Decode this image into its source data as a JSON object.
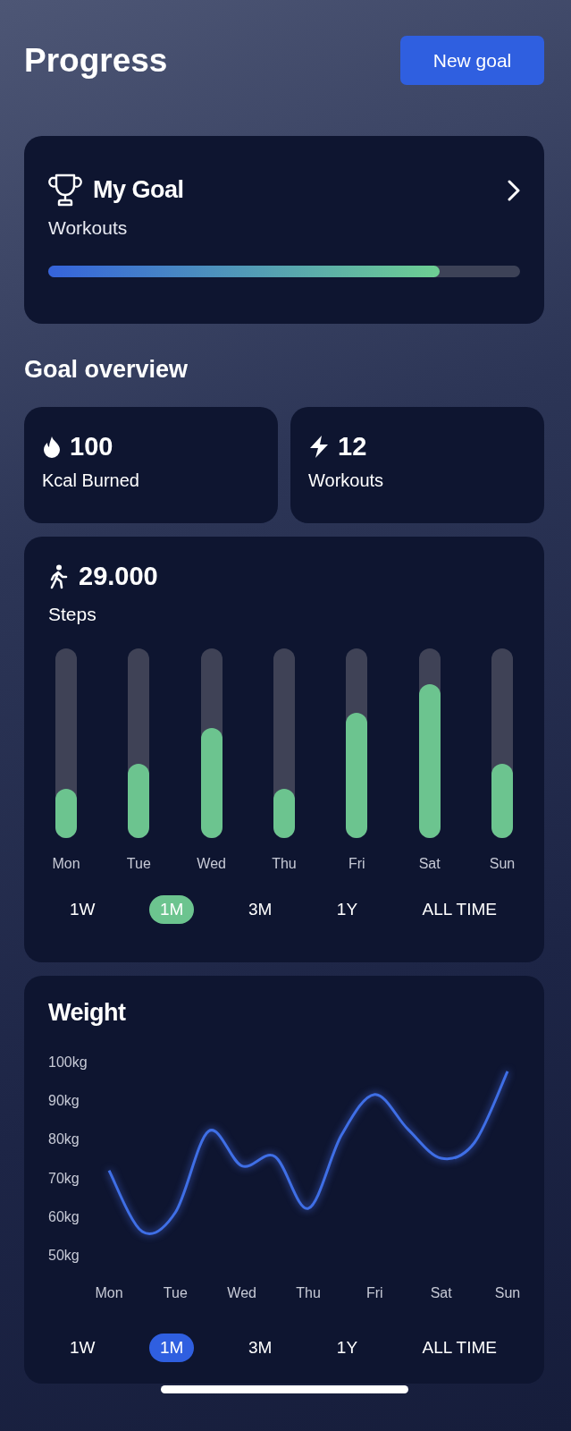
{
  "header": {
    "title": "Progress",
    "button": "New goal"
  },
  "goal_card": {
    "title": "My Goal",
    "subtitle": "Workouts",
    "level": 0.83
  },
  "section_title": "Goal overview",
  "stats": [
    {
      "kind": "flame",
      "value": "100",
      "label": "Kcal Burned"
    },
    {
      "kind": "bolt",
      "value": "12",
      "label": "Workouts"
    }
  ],
  "steps_card": {
    "value": "29.000",
    "label": "Steps",
    "bars": [
      {
        "day": "Mon",
        "level": 0.26
      },
      {
        "day": "Tue",
        "level": 0.39
      },
      {
        "day": "Wed",
        "level": 0.58
      },
      {
        "day": "Thu",
        "level": 0.26
      },
      {
        "day": "Fri",
        "level": 0.66
      },
      {
        "day": "Sat",
        "level": 0.81
      },
      {
        "day": "Sun",
        "level": 0.39
      }
    ],
    "ranges": [
      {
        "label": "1W",
        "selected": false
      },
      {
        "label": "1M",
        "selected": true
      },
      {
        "label": "3M",
        "selected": false
      },
      {
        "label": "1Y",
        "selected": false
      },
      {
        "label": "ALL TIME",
        "selected": false
      }
    ]
  },
  "weight_card": {
    "title": "Weight",
    "chart_data": {
      "type": "line",
      "categories": [
        "Mon",
        null,
        "Tue",
        null,
        "Wed",
        null,
        "Thu",
        null,
        "Fri",
        null,
        "Sat",
        null,
        "Sun"
      ],
      "series": [
        {
          "color": "#3f6fe6",
          "values": [
            71.8,
            56,
            61,
            82,
            73,
            75.4,
            62,
            81,
            91.5,
            82.5,
            75,
            79,
            97.5
          ]
        }
      ],
      "ylim": [
        50,
        100
      ],
      "yticks": [
        {
          "value": 100,
          "label": "100kg"
        },
        {
          "value": 90,
          "label": "90kg"
        },
        {
          "value": 80,
          "label": "80kg"
        },
        {
          "value": 70,
          "label": "70kg"
        },
        {
          "value": 60,
          "label": "60kg"
        },
        {
          "value": 50,
          "label": "50kg"
        }
      ]
    },
    "ranges": [
      {
        "label": "1W",
        "selected": false
      },
      {
        "label": "1M",
        "selected": true
      },
      {
        "label": "3M",
        "selected": false
      },
      {
        "label": "1Y",
        "selected": false
      },
      {
        "label": "ALL TIME",
        "selected": false
      }
    ]
  }
}
